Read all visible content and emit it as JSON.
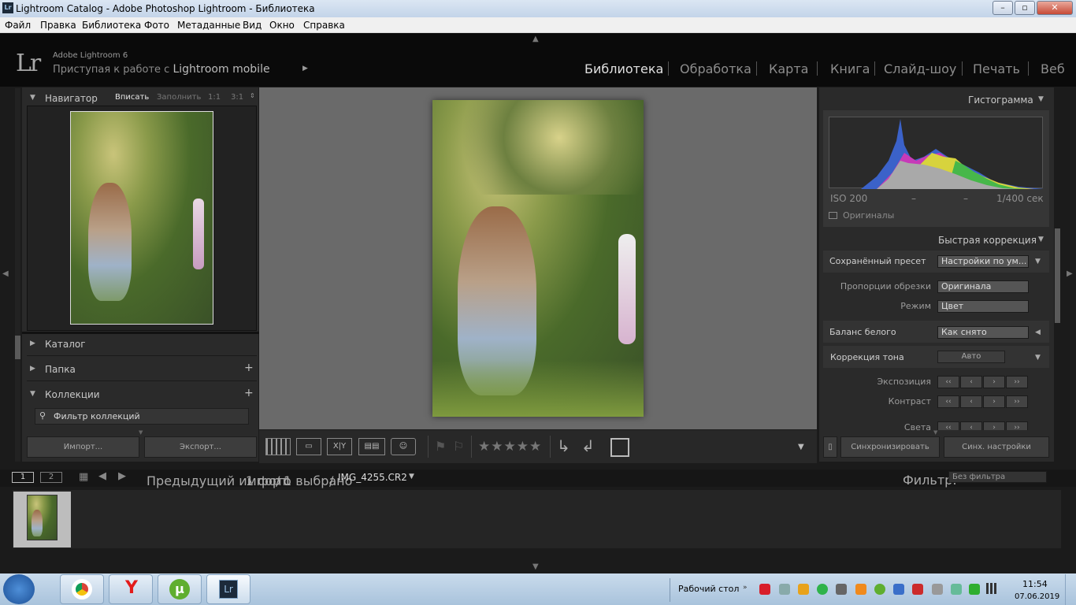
{
  "window": {
    "title": "Lightroom Catalog - Adobe Photoshop Lightroom - Библиотека",
    "app_icon": "Lr"
  },
  "menu": [
    "Файл",
    "Правка",
    "Библиотека",
    "Фото",
    "Метаданные",
    "Вид",
    "Окно",
    "Справка"
  ],
  "identity": {
    "logo": "Lr",
    "version": "Adobe Lightroom 6",
    "mobile_prefix": "Приступая к работе с",
    "mobile_product": "Lightroom mobile"
  },
  "modules": [
    "Библиотека",
    "Обработка",
    "Карта",
    "Книга",
    "Слайд-шоу",
    "Печать",
    "Веб"
  ],
  "active_module": "Библиотека",
  "navigator": {
    "title": "Навигатор",
    "zoom": [
      "Вписать",
      "Заполнить",
      "1:1",
      "3:1"
    ],
    "active_zoom": "Вписать"
  },
  "left_sections": {
    "catalog": "Каталог",
    "folders": "Папка",
    "collections": "Коллекции",
    "filter_placeholder": "Фильтр коллекций"
  },
  "left_buttons": {
    "import": "Импорт...",
    "export": "Экспорт..."
  },
  "histogram": {
    "title": "Гистограмма",
    "iso": "ISO 200",
    "dash1": "–",
    "dash2": "–",
    "shutter": "1/400 сек",
    "originals": "Оригиналы"
  },
  "quick_develop": {
    "title": "Быстрая коррекция",
    "saved_preset_label": "Сохранённый пресет",
    "saved_preset_value": "Настройки по ум...",
    "crop_label": "Пропорции обрезки",
    "crop_value": "Оригинала",
    "mode_label": "Режим",
    "mode_value": "Цвет",
    "wb_label": "Баланс белого",
    "wb_value": "Как снято",
    "tone_label": "Коррекция тона",
    "auto_label": "Авто",
    "exposure_label": "Экспозиция",
    "contrast_label": "Контраст",
    "highlights_label": "Света"
  },
  "right_buttons": {
    "sync": "Синхронизировать",
    "sync_settings": "Синх. настройки"
  },
  "filmstrip": {
    "screen1": "1",
    "screen2": "2",
    "source": "Предыдущий импорт",
    "count": "1 фото",
    "selected": "1 выбрано",
    "sep": "/",
    "filename": "IMG_4255.CR2",
    "filter_label": "Фильтр:",
    "filter_value": "Без фильтра"
  },
  "taskbar": {
    "desktop": "Рабочий стол",
    "time": "11:54",
    "date": "07.06.2019"
  },
  "toolbar_icons": [
    "grid-view-icon",
    "loupe-view-icon",
    "compare-view-icon",
    "survey-view-icon",
    "people-view-icon",
    "flag-icon",
    "reject-flag-icon",
    "rotate-left-icon",
    "rotate-right-icon",
    "crop-frame-icon"
  ],
  "rating_stars": 5
}
